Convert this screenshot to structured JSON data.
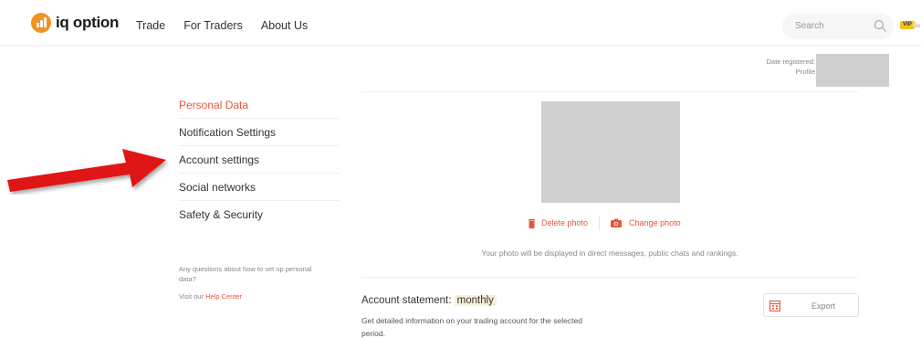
{
  "header": {
    "logo_text": "iq option",
    "nav": [
      "Trade",
      "For Traders",
      "About Us"
    ],
    "search_placeholder": "Search",
    "vip_badge": "VIP"
  },
  "registration": {
    "date_label": "Date registered:",
    "profile_label": "Profile"
  },
  "sidebar": {
    "items": [
      {
        "label": "Personal Data",
        "active": true
      },
      {
        "label": "Notification Settings",
        "active": false
      },
      {
        "label": "Account settings",
        "active": false
      },
      {
        "label": "Social networks",
        "active": false
      },
      {
        "label": "Safety & Security",
        "active": false
      }
    ],
    "help_question": "Any questions about how to set up personal data?",
    "help_visit_prefix": "Visit our",
    "help_center_link": "Help Center"
  },
  "photo": {
    "delete_label": "Delete photo",
    "change_label": "Change photo",
    "note": "Your photo will be displayed in direct messages, public chats and rankings."
  },
  "statement": {
    "title": "Account statement:",
    "period": "monthly",
    "description": "Get detailed information on your trading account for the selected period.",
    "export_label": "Export"
  },
  "colors": {
    "accent": "#e8553a",
    "brand": "#f39221",
    "arrow": "#e01818"
  },
  "icons": [
    "logo-icon",
    "search-icon",
    "crown-icon",
    "trash-icon",
    "camera-icon",
    "calendar-icon",
    "red-arrow-icon"
  ]
}
